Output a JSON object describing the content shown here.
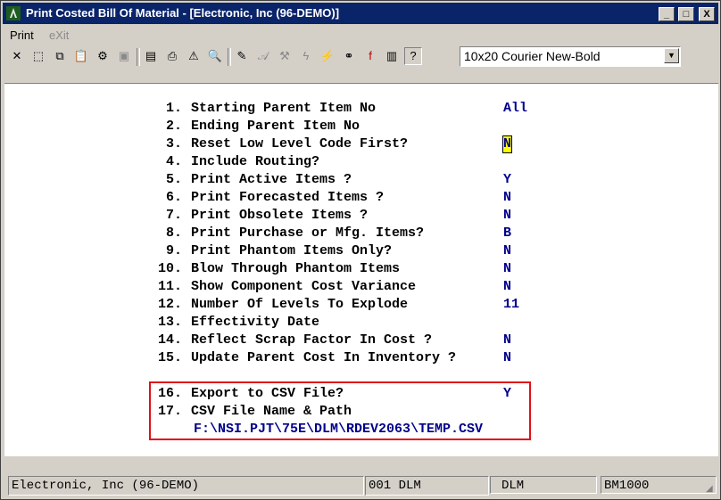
{
  "window": {
    "title": "Print Costed Bill Of Material - [Electronic, Inc (96-DEMO)]",
    "controls": [
      "_",
      "□",
      "X"
    ]
  },
  "menu": [
    "Print",
    "eXit"
  ],
  "toolbar": {
    "font_selector": "10x20 Courier New-Bold"
  },
  "form": {
    "rows": [
      {
        "num": " 1.",
        "label": "Starting Parent Item No",
        "value": "All"
      },
      {
        "num": " 2.",
        "label": "Ending Parent Item No",
        "value": ""
      },
      {
        "num": " 3.",
        "label": "Reset Low Level Code First?",
        "value": "N"
      },
      {
        "num": " 4.",
        "label": "Include Routing?",
        "value": ""
      },
      {
        "num": " 5.",
        "label": "Print Active Items ?",
        "value": "Y"
      },
      {
        "num": " 6.",
        "label": "Print Forecasted Items ?",
        "value": "N"
      },
      {
        "num": " 7.",
        "label": "Print Obsolete Items ?",
        "value": "N"
      },
      {
        "num": " 8.",
        "label": "Print Purchase or Mfg. Items?",
        "value": "B"
      },
      {
        "num": " 9.",
        "label": "Print Phantom Items Only?",
        "value": "N"
      },
      {
        "num": "10.",
        "label": "Blow Through Phantom Items",
        "value": "N"
      },
      {
        "num": "11.",
        "label": "Show Component Cost Variance",
        "value": "N"
      },
      {
        "num": "12.",
        "label": "Number Of Levels To Explode",
        "value": "11"
      },
      {
        "num": "13.",
        "label": "Effectivity Date",
        "value": ""
      },
      {
        "num": "14.",
        "label": "Reflect Scrap Factor In Cost ?",
        "value": "N"
      },
      {
        "num": "15.",
        "label": "Update Parent Cost In Inventory ?",
        "value": "N"
      },
      {
        "num": "16.",
        "label": "Export to CSV File?",
        "value": "Y"
      },
      {
        "num": "17.",
        "label": "CSV File Name & Path",
        "value": ""
      }
    ],
    "csv_path": "F:\\NSI.PJT\\75E\\DLM\\RDEV2063\\TEMP.CSV"
  },
  "status": {
    "company": "Electronic, Inc (96-DEMO)",
    "user_code": "001 DLM",
    "user": "DLM",
    "program": "BM1000"
  }
}
